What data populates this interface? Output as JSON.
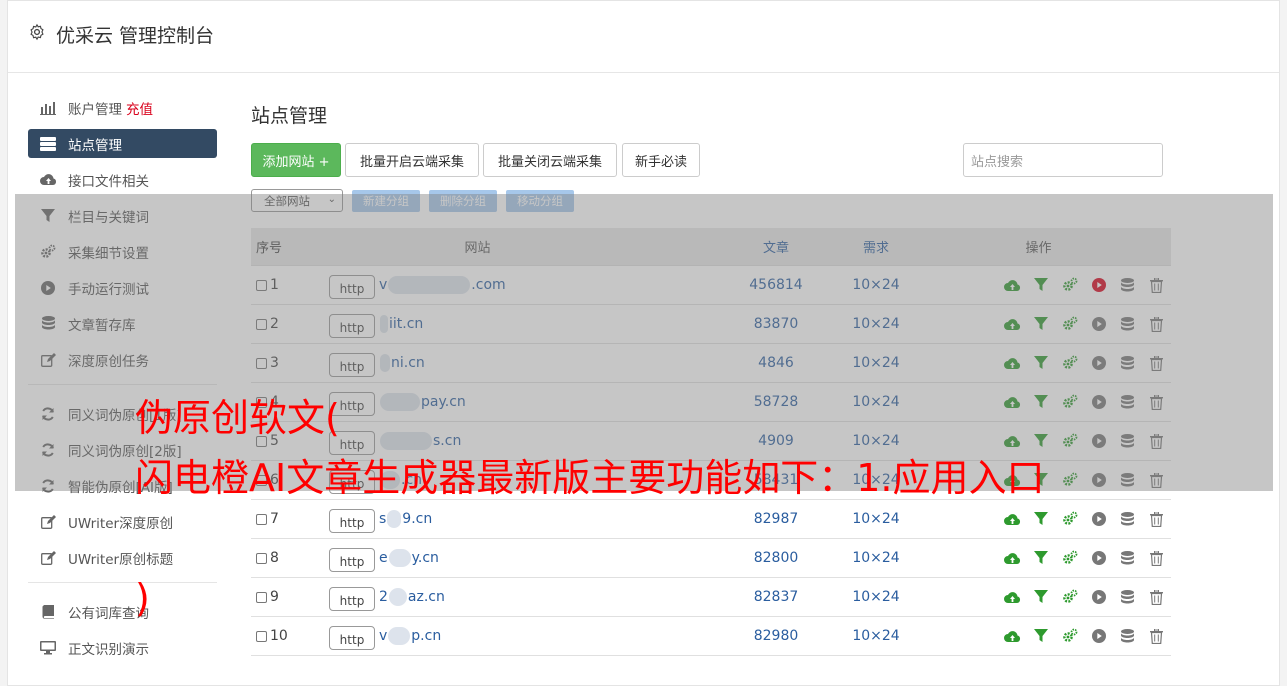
{
  "header": {
    "title": "优采云 管理控制台"
  },
  "sidebar": {
    "items": [
      {
        "label": "账户管理",
        "extra": "充值",
        "icon": "bar-chart-icon",
        "active": false
      },
      {
        "label": "站点管理",
        "icon": "server-icon",
        "active": true
      },
      {
        "label": "接口文件相关",
        "icon": "cloud-upload-icon",
        "active": false
      },
      {
        "label": "栏目与关键词",
        "icon": "filter-icon",
        "active": false
      },
      {
        "label": "采集细节设置",
        "icon": "cogs-icon",
        "active": false
      },
      {
        "label": "手动运行测试",
        "icon": "play-circle-icon",
        "active": false
      },
      {
        "label": "文章暂存库",
        "icon": "database-icon",
        "active": false
      },
      {
        "label": "深度原创任务",
        "icon": "edit-icon",
        "active": false
      }
    ],
    "items2": [
      {
        "label": "同义词伪原创[1版]",
        "icon": "refresh-icon"
      },
      {
        "label": "同义词伪原创[2版]",
        "icon": "refresh-icon"
      },
      {
        "label": "智能伪原创[AI版]",
        "icon": "refresh-icon"
      },
      {
        "label": "UWriter深度原创",
        "icon": "edit-icon"
      },
      {
        "label": "UWriter原创标题",
        "icon": "edit-icon"
      }
    ],
    "items3": [
      {
        "label": "公有词库查询",
        "icon": "book-icon"
      },
      {
        "label": "正文识别演示",
        "icon": "monitor-icon"
      }
    ]
  },
  "main": {
    "title": "站点管理",
    "buttons": {
      "add": "添加网站 +",
      "open_cloud": "批量开启云端采集",
      "close_cloud": "批量关闭云端采集",
      "guide": "新手必读"
    },
    "search_placeholder": "站点搜索",
    "group_select": "全部网站",
    "group_buttons": {
      "new": "新建分组",
      "delete": "删除分组",
      "move": "移动分组"
    },
    "table": {
      "headers": {
        "no": "序号",
        "site": "网站",
        "articles": "文章",
        "demand": "需求",
        "ops": "操作"
      },
      "http_label": "http",
      "rows": [
        {
          "no": "1",
          "pre": "v",
          "post": ".com",
          "articles": "456814",
          "demand": "10×24",
          "play_red": true
        },
        {
          "no": "2",
          "pre": "",
          "post": "iit.cn",
          "articles": "83870",
          "demand": "10×24",
          "play_red": false
        },
        {
          "no": "3",
          "pre": "",
          "post": "ni.cn",
          "articles": "4846",
          "demand": "10×24",
          "play_red": false
        },
        {
          "no": "4",
          "pre": "",
          "post": "pay.cn",
          "articles": "58728",
          "demand": "10×24",
          "play_red": false
        },
        {
          "no": "5",
          "pre": "",
          "post": "s.cn",
          "articles": "4909",
          "demand": "10×24",
          "play_red": false
        },
        {
          "no": "6",
          "pre": "",
          "post": ".cn",
          "articles": "58431",
          "demand": "10×24",
          "play_red": false
        },
        {
          "no": "7",
          "pre": "s",
          "post": "9.cn",
          "articles": "82987",
          "demand": "10×24",
          "play_red": false
        },
        {
          "no": "8",
          "pre": "e",
          "post": "y.cn",
          "articles": "82800",
          "demand": "10×24",
          "play_red": false
        },
        {
          "no": "9",
          "pre": "2",
          "post": "az.cn",
          "articles": "82837",
          "demand": "10×24",
          "play_red": false
        },
        {
          "no": "10",
          "pre": "v",
          "post": "p.cn",
          "articles": "82980",
          "demand": "10×24",
          "play_red": false
        }
      ]
    }
  },
  "overlay_text": {
    "line1": "伪原创软文(",
    "line2": "闪电橙AI文章生成器最新版主要功能如下：1.应用入口",
    "line3": ")"
  },
  "colors": {
    "accent_green": "#5cb85c",
    "nav_active": "#334a63",
    "link": "#2a5d9f",
    "overlay_red": "#ff0000"
  }
}
